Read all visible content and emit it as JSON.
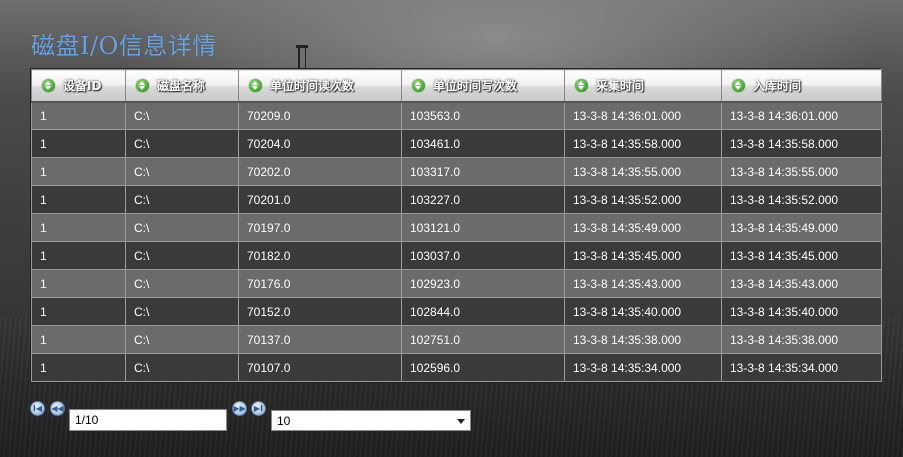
{
  "page": {
    "title": "磁盘I/O信息详情"
  },
  "table": {
    "columns": [
      {
        "label": "设备ID",
        "icon": "sort-icon"
      },
      {
        "label": "磁盘名称",
        "icon": "sort-icon"
      },
      {
        "label": "单位时间读次数",
        "icon": "sort-icon"
      },
      {
        "label": "单位时间写次数",
        "icon": "sort-icon"
      },
      {
        "label": "采集时间",
        "icon": "sort-icon"
      },
      {
        "label": "入库时间",
        "icon": "sort-icon"
      }
    ],
    "rows": [
      [
        "1",
        "C:\\",
        "70209.0",
        "103563.0",
        "13-3-8 14:36:01.000",
        "13-3-8 14:36:01.000"
      ],
      [
        "1",
        "C:\\",
        "70204.0",
        "103461.0",
        "13-3-8 14:35:58.000",
        "13-3-8 14:35:58.000"
      ],
      [
        "1",
        "C:\\",
        "70202.0",
        "103317.0",
        "13-3-8 14:35:55.000",
        "13-3-8 14:35:55.000"
      ],
      [
        "1",
        "C:\\",
        "70201.0",
        "103227.0",
        "13-3-8 14:35:52.000",
        "13-3-8 14:35:52.000"
      ],
      [
        "1",
        "C:\\",
        "70197.0",
        "103121.0",
        "13-3-8 14:35:49.000",
        "13-3-8 14:35:49.000"
      ],
      [
        "1",
        "C:\\",
        "70182.0",
        "103037.0",
        "13-3-8 14:35:45.000",
        "13-3-8 14:35:45.000"
      ],
      [
        "1",
        "C:\\",
        "70176.0",
        "102923.0",
        "13-3-8 14:35:43.000",
        "13-3-8 14:35:43.000"
      ],
      [
        "1",
        "C:\\",
        "70152.0",
        "102844.0",
        "13-3-8 14:35:40.000",
        "13-3-8 14:35:40.000"
      ],
      [
        "1",
        "C:\\",
        "70137.0",
        "102751.0",
        "13-3-8 14:35:38.000",
        "13-3-8 14:35:38.000"
      ],
      [
        "1",
        "C:\\",
        "70107.0",
        "102596.0",
        "13-3-8 14:35:34.000",
        "13-3-8 14:35:34.000"
      ]
    ]
  },
  "pager": {
    "first_icon": "first-page-icon",
    "prev_icon": "prev-page-icon",
    "next_icon": "next-page-icon",
    "last_icon": "last-page-icon",
    "page_value": "1/10",
    "page_size": "10"
  },
  "colors": {
    "title": "#6aa2e0",
    "row_odd": "#6b6b6b",
    "row_even": "#3a3a3a",
    "sort_icon": "#4fae3a"
  }
}
